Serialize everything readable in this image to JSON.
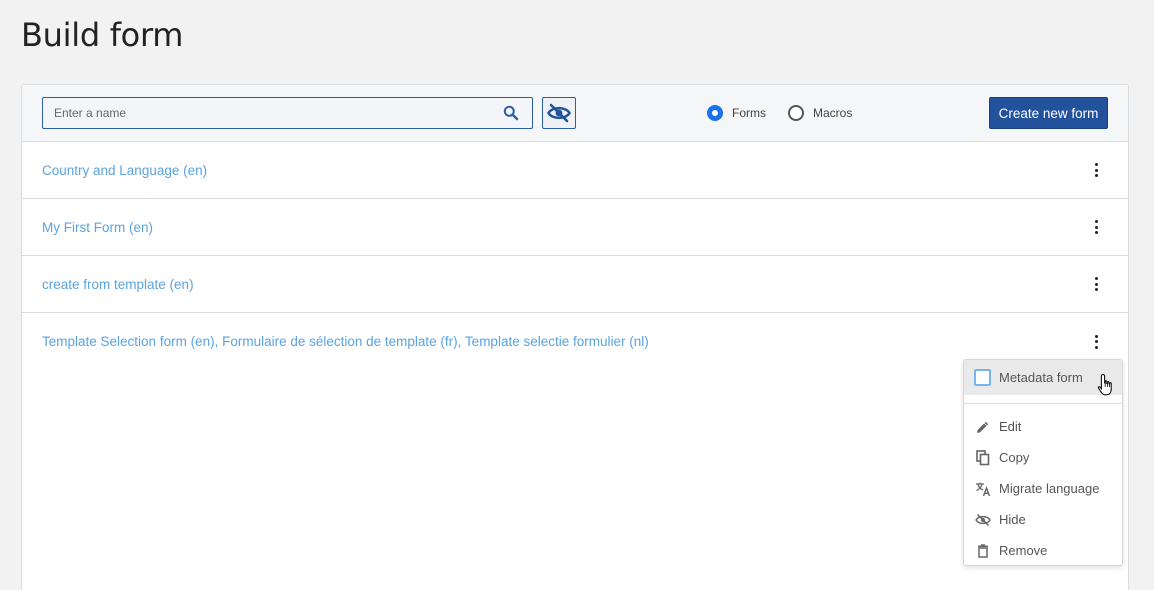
{
  "page": {
    "title": "Build form"
  },
  "toolbar": {
    "search_placeholder": "Enter a name",
    "search_value": "",
    "radio_forms": "Forms",
    "radio_macros": "Macros",
    "selected_radio": "Forms",
    "create_label": "Create new form"
  },
  "forms": [
    {
      "label": "Country and Language (en)"
    },
    {
      "label": "My First Form (en)"
    },
    {
      "label": "create from template (en)"
    },
    {
      "label": "Template Selection form (en), Formulaire de sélection de template (fr), Template selectie formulier (nl)"
    }
  ],
  "menu": {
    "metadata_label": "Metadata form",
    "metadata_checked": false,
    "items": [
      {
        "label": "Edit",
        "icon": "pencil-icon"
      },
      {
        "label": "Copy",
        "icon": "copy-icon"
      },
      {
        "label": "Migrate language",
        "icon": "translate-icon"
      },
      {
        "label": "Hide",
        "icon": "eye-off-icon"
      },
      {
        "label": "Remove",
        "icon": "trash-icon"
      }
    ]
  },
  "colors": {
    "primary": "#22529c",
    "link": "#5aa3e0",
    "radio_selected": "#1a73e8"
  }
}
